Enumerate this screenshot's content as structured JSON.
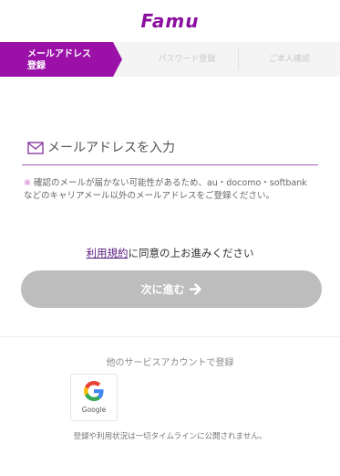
{
  "header": {
    "logo_text": "Famu"
  },
  "steps": {
    "active_line1": "メールアドレス",
    "active_line2": "登録",
    "step2": "パスワード登録",
    "step3": "ご本人確認"
  },
  "form": {
    "email_placeholder": "メールアドレスを入力",
    "note_mark": "※",
    "note_text": "確認のメールが届かない可能性があるため、au・docomo・softbankなどのキャリアメール以外のメールアドレスをご登録ください。"
  },
  "terms": {
    "link_text": "利用規約",
    "rest_text": "に同意の上お進みください"
  },
  "next_button": {
    "label": "次に進む"
  },
  "other_services": {
    "label": "他のサービスアカウントで登録",
    "google_label": "Google"
  },
  "privacy_note": "登録や利用状況は一切タイムラインに公開されません。",
  "colors": {
    "brand": "#9b11a8",
    "button_disabled": "#bdbdbd",
    "link": "#5c2180"
  }
}
